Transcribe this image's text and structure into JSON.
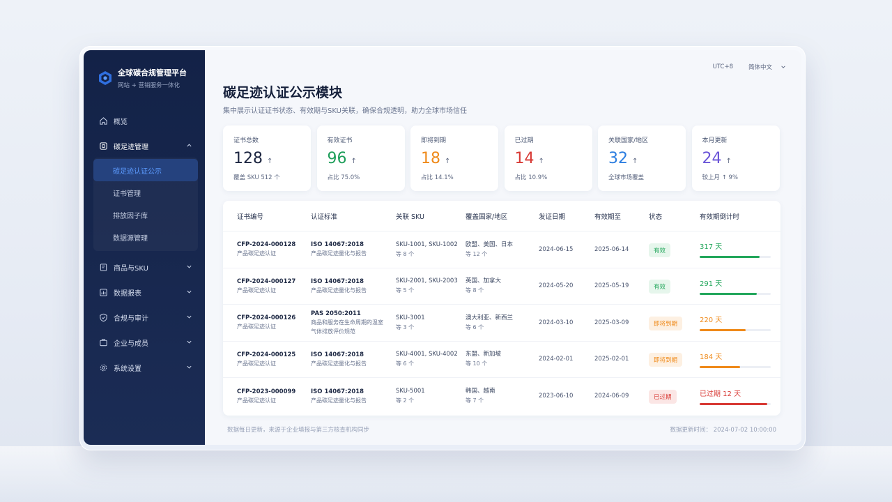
{
  "sidebar": {
    "brand_title": "全球碳合规管理平台",
    "brand_sub": "网站 + 营销服务一体化",
    "items": [
      {
        "label": "概览",
        "icon": "home-icon"
      },
      {
        "label": "碳足迹管理",
        "icon": "footprint-icon",
        "expanded": true,
        "children": [
          "碳足迹认证公示",
          "证书管理",
          "排放因子库",
          "数据源管理"
        ],
        "active_child": 0
      },
      {
        "label": "商品与SKU",
        "icon": "product-icon"
      },
      {
        "label": "数据报表",
        "icon": "report-icon"
      },
      {
        "label": "合规与审计",
        "icon": "audit-icon"
      },
      {
        "label": "企业与成员",
        "icon": "members-icon"
      },
      {
        "label": "系统设置",
        "icon": "settings-icon"
      }
    ]
  },
  "topbar": {
    "timezone": "UTC+8",
    "language": "简体中文"
  },
  "page": {
    "title": "碳足迹认证公示模块",
    "subtitle": "集中展示认证证书状态、有效期与SKU关联，确保合规透明，助力全球市场信任"
  },
  "stats": [
    {
      "label": "证书总数",
      "value": "128",
      "arrow": "↑",
      "foot": "覆盖 SKU 512 个",
      "color": "#1c2540"
    },
    {
      "label": "有效证书",
      "value": "96",
      "arrow": "↑",
      "foot": "占比 75.0%",
      "color": "#1e9e5a"
    },
    {
      "label": "即将到期",
      "value": "18",
      "arrow": "↑",
      "foot": "占比 14.1%",
      "color": "#ef8a1a"
    },
    {
      "label": "已过期",
      "value": "14",
      "arrow": "↑",
      "foot": "占比 10.9%",
      "color": "#d83a35"
    },
    {
      "label": "关联国家/地区",
      "value": "32",
      "arrow": "↑",
      "foot": "全球市场覆盖",
      "color": "#2b7de0"
    },
    {
      "label": "本月更新",
      "value": "24",
      "arrow": "↑",
      "foot": "较上月 ↑ 9%",
      "color": "#6b55d8"
    }
  ],
  "table": {
    "headers": [
      "证书编号",
      "认证标准",
      "关联 SKU",
      "覆盖国家/地区",
      "发证日期",
      "有效期至",
      "状态",
      "有效期倒计时"
    ],
    "rows": [
      {
        "id": "CFP-2024-000128",
        "id_sub": "产品碳足迹认证",
        "std": "ISO 14067:2018",
        "std_sub": "产品碳足迹量化与报告",
        "sku": "SKU-1001, SKU-1002",
        "sku_sub": "等 8 个",
        "region": "欧盟、美国、日本",
        "region_sub": "等 12 个",
        "issued": "2024-06-15",
        "expires": "2025-06-14",
        "status": "有效",
        "countdown": "317 天",
        "progress": 0.84,
        "tone": "green"
      },
      {
        "id": "CFP-2024-000127",
        "id_sub": "产品碳足迹认证",
        "std": "ISO 14067:2018",
        "std_sub": "产品碳足迹量化与报告",
        "sku": "SKU-2001, SKU-2003",
        "sku_sub": "等 5 个",
        "region": "英国、加拿大",
        "region_sub": "等 8 个",
        "issued": "2024-05-20",
        "expires": "2025-05-19",
        "status": "有效",
        "countdown": "291 天",
        "progress": 0.8,
        "tone": "green"
      },
      {
        "id": "CFP-2024-000126",
        "id_sub": "产品碳足迹认证",
        "std": "PAS 2050:2011",
        "std_sub": "商品和服务在生命周期的温室气体排放评价规范",
        "sku": "SKU-3001",
        "sku_sub": "等 3 个",
        "region": "澳大利亚、新西兰",
        "region_sub": "等 6 个",
        "issued": "2024-03-10",
        "expires": "2025-03-09",
        "status": "即将到期",
        "countdown": "220 天",
        "progress": 0.65,
        "tone": "orange"
      },
      {
        "id": "CFP-2024-000125",
        "id_sub": "产品碳足迹认证",
        "std": "ISO 14067:2018",
        "std_sub": "产品碳足迹量化与报告",
        "sku": "SKU-4001, SKU-4002",
        "sku_sub": "等 6 个",
        "region": "东盟、新加坡",
        "region_sub": "等 10 个",
        "issued": "2024-02-01",
        "expires": "2025-02-01",
        "status": "即将到期",
        "countdown": "184 天",
        "progress": 0.57,
        "tone": "orange"
      },
      {
        "id": "CFP-2023-000099",
        "id_sub": "产品碳足迹认证",
        "std": "ISO 14067:2018",
        "std_sub": "产品碳足迹量化与报告",
        "sku": "SKU-5001",
        "sku_sub": "等 2 个",
        "region": "韩国、越南",
        "region_sub": "等 7 个",
        "issued": "2023-06-10",
        "expires": "2024-06-09",
        "status": "已过期",
        "countdown": "已过期 12 天",
        "progress": 0.95,
        "tone": "red"
      }
    ]
  },
  "footer": {
    "note": "数据每日更新，来源于企业填报与第三方核查机构同步",
    "updated": "数据更新时间：  2024-07-02 10:00:00"
  },
  "colors": {
    "green": "#22a65b",
    "green_bg": "#e6f6ec",
    "orange": "#ef8a1a",
    "orange_bg": "#fdf0e2",
    "red": "#d83a35",
    "red_bg": "#fbe6e5",
    "accent": "#2f6fe0"
  }
}
